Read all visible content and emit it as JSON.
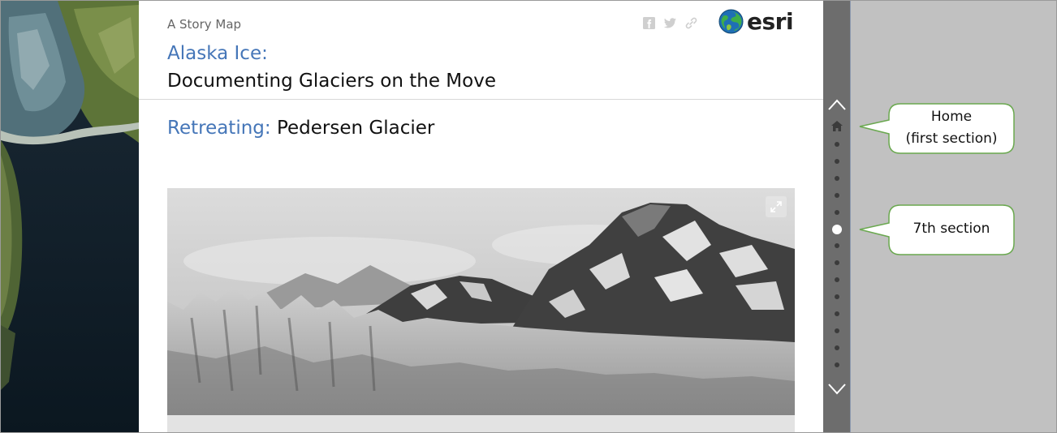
{
  "map": {
    "description_icon": "satellite-map"
  },
  "header": {
    "kicker": "A Story Map",
    "title_line1": "Alaska Ice:",
    "title_line2": "Documenting Glaciers on the Move",
    "share": [
      "facebook-icon",
      "twitter-icon",
      "link-icon"
    ],
    "logo_text": "esri"
  },
  "section": {
    "heading_accent": "Retreating:",
    "heading_rest": " Pedersen Glacier"
  },
  "navigation": {
    "total_sections": 15,
    "active_section": 7,
    "home_icon": "home-icon"
  },
  "callouts": {
    "home_line1": "Home",
    "home_line2": "(first section)",
    "seventh": "7th section"
  },
  "colors": {
    "accent": "#4576b8",
    "rail": "#6d6d6d",
    "callout_border": "#6aa84f"
  }
}
